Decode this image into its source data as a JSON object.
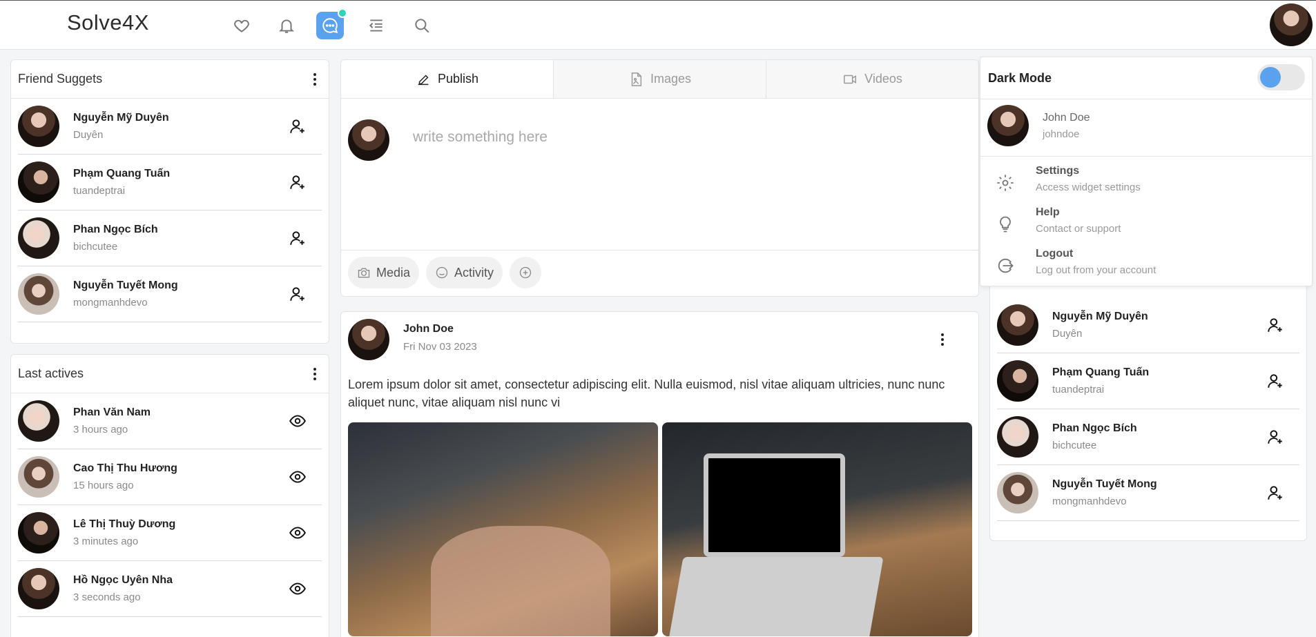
{
  "header": {
    "logo": "Solve4X",
    "icons": [
      "heart-icon",
      "bell-icon",
      "chat-icon",
      "menu-indent-icon",
      "search-icon"
    ],
    "accent_color": "#5aa2ee",
    "notification_dot_color": "#2ed3bd"
  },
  "friend_suggests": {
    "title": "Friend Suggets",
    "items": [
      {
        "name": "Nguyễn Mỹ Duyên",
        "sub": "Duyên"
      },
      {
        "name": "Phạm Quang Tuấn",
        "sub": "tuandeptrai"
      },
      {
        "name": "Phan Ngọc Bích",
        "sub": "bichcutee"
      },
      {
        "name": "Nguyễn Tuyết Mong",
        "sub": "mongmanhdevo"
      }
    ]
  },
  "last_actives": {
    "title": "Last actives",
    "items": [
      {
        "name": "Phan Văn Nam",
        "sub": "3 hours ago"
      },
      {
        "name": "Cao Thị Thu Hương",
        "sub": "15 hours ago"
      },
      {
        "name": "Lê Thị Thuỳ Dương",
        "sub": "3 minutes ago"
      },
      {
        "name": "Hồ Ngọc Uyên Nha",
        "sub": "3 seconds ago"
      }
    ]
  },
  "composer": {
    "tabs": [
      "Publish",
      "Images",
      "Videos"
    ],
    "placeholder": "write something here",
    "actions": [
      "Media",
      "Activity"
    ]
  },
  "post": {
    "author": "John Doe",
    "date": "Fri Nov 03 2023",
    "text": "Lorem ipsum dolor sit amet, consectetur adipiscing elit. Nulla euismod, nisl vitae aliquam ultricies, nunc nunc aliquet nunc, vitae aliquam nisl nunc vi"
  },
  "dropdown": {
    "dark_mode_label": "Dark Mode",
    "dark_mode_on": false,
    "user_name": "John Doe",
    "user_handle": "johndoe",
    "items": [
      {
        "title": "Settings",
        "sub": "Access widget settings",
        "icon": "gear-icon"
      },
      {
        "title": "Help",
        "sub": "Contact or support",
        "icon": "lightbulb-icon"
      },
      {
        "title": "Logout",
        "sub": "Log out from your account",
        "icon": "logout-icon"
      }
    ]
  },
  "right_suggests": {
    "items": [
      {
        "name": "Nguyễn Mỹ Duyên",
        "sub": "Duyên"
      },
      {
        "name": "Phạm Quang Tuấn",
        "sub": "tuandeptrai"
      },
      {
        "name": "Phan Ngọc Bích",
        "sub": "bichcutee"
      },
      {
        "name": "Nguyễn Tuyết Mong",
        "sub": "mongmanhdevo"
      }
    ]
  }
}
